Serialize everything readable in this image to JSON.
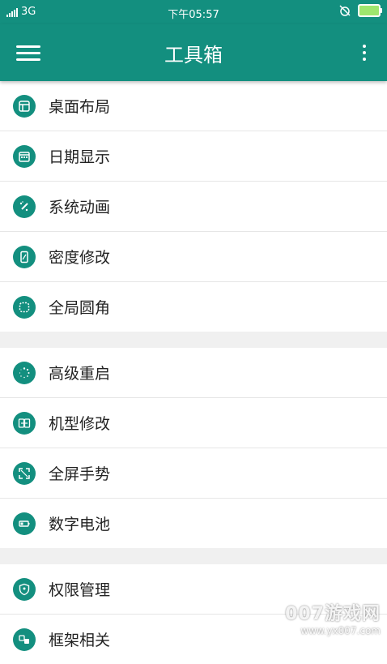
{
  "status": {
    "network": "3G",
    "time": "下午05:57"
  },
  "toolbar": {
    "title": "工具箱"
  },
  "groups": [
    {
      "items": [
        {
          "label": "桌面布局",
          "icon": "layout-icon"
        },
        {
          "label": "日期显示",
          "icon": "calendar-icon"
        },
        {
          "label": "系统动画",
          "icon": "animation-wand-icon"
        },
        {
          "label": "密度修改",
          "icon": "phone-density-icon"
        },
        {
          "label": "全局圆角",
          "icon": "rounded-corner-icon"
        }
      ]
    },
    {
      "items": [
        {
          "label": "高级重启",
          "icon": "restart-icon"
        },
        {
          "label": "机型修改",
          "icon": "device-model-icon"
        },
        {
          "label": "全屏手势",
          "icon": "fullscreen-gesture-icon"
        },
        {
          "label": "数字电池",
          "icon": "battery-icon"
        }
      ]
    },
    {
      "items": [
        {
          "label": "权限管理",
          "icon": "permission-shield-icon"
        },
        {
          "label": "框架相关",
          "icon": "framework-icon"
        }
      ]
    }
  ],
  "watermark": {
    "big": "007游戏网",
    "small": "www.yx007.com"
  },
  "colors": {
    "accent": "#138f7f"
  }
}
